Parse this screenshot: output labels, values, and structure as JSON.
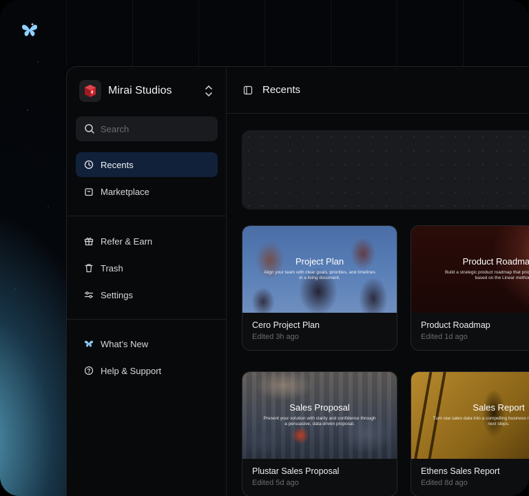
{
  "brand": {
    "logo_icon": "butterfly-icon",
    "accent": "#8fd0ff"
  },
  "sidebar": {
    "org_name": "Mirai Studios",
    "search_placeholder": "Search",
    "primary_items": [
      {
        "label": "Recents",
        "icon": "clock-icon",
        "active": true
      },
      {
        "label": "Marketplace",
        "icon": "shopping-bag-icon"
      }
    ],
    "secondary_items": [
      {
        "label": "Refer & Earn",
        "icon": "gift-icon"
      },
      {
        "label": "Trash",
        "icon": "trash-icon"
      },
      {
        "label": "Settings",
        "icon": "sliders-icon"
      }
    ],
    "tertiary_items": [
      {
        "label": "What’s New",
        "icon": "butterfly-icon"
      },
      {
        "label": "Help & Support",
        "icon": "help-circle-icon"
      }
    ]
  },
  "main": {
    "title": "Recents",
    "cards": [
      {
        "thumb_title": "Project Plan",
        "thumb_desc": "Align your team with clear goals, priorities, and timelines in a living document.",
        "name": "Cero Project Plan",
        "meta": "Edited 3h ago"
      },
      {
        "thumb_title": "Product Roadmap",
        "thumb_desc": "Build a strategic product roadmap that prioritizes ruthlessly, based on the Linear method.",
        "name": "Product Roadmap",
        "meta": "Edited 1d ago"
      },
      {
        "thumb_title": "Sales Proposal",
        "thumb_desc": "Present your solution with clarity and confidence through a persuasive, data-driven proposal.",
        "name": "Plustar Sales Proposal",
        "meta": "Edited 5d ago"
      },
      {
        "thumb_title": "Sales Report",
        "thumb_desc": "Turn raw sales data into a compelling business narrative and clear next steps.",
        "name": "Ethens Sales Report",
        "meta": "Edited 8d ago"
      }
    ]
  }
}
